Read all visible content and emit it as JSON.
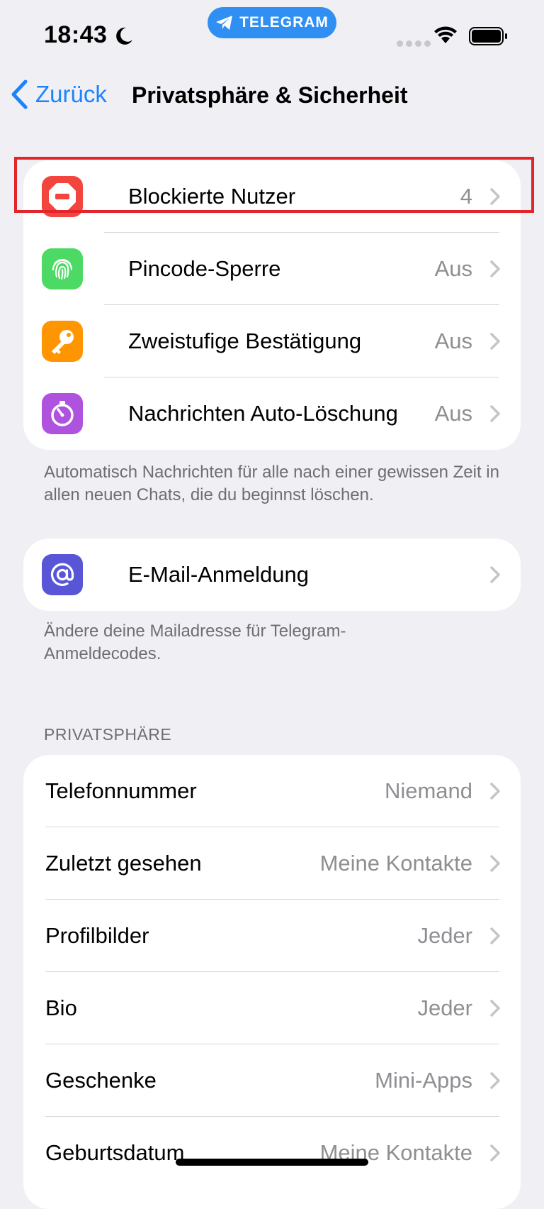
{
  "status": {
    "time": "18:43",
    "app_pill": "TELEGRAM"
  },
  "nav": {
    "back_label": "Zurück",
    "title": "Privatsphäre & Sicherheit"
  },
  "security": {
    "items": [
      {
        "label": "Blockierte Nutzer",
        "value": "4",
        "icon": "blocked-icon",
        "color": "#f2453d"
      },
      {
        "label": "Pincode-Sperre",
        "value": "Aus",
        "icon": "fingerprint-icon",
        "color": "#4cd964"
      },
      {
        "label": "Zweistufige Bestätigung",
        "value": "Aus",
        "icon": "key-icon",
        "color": "#ff9500"
      },
      {
        "label": "Nachrichten Auto-Löschung",
        "value": "Aus",
        "icon": "timer-icon",
        "color": "#af52de"
      }
    ],
    "footer": "Automatisch Nachrichten für alle nach einer gewissen Zeit in allen neuen Chats, die du beginnst löschen."
  },
  "email": {
    "label": "E-Mail-Anmeldung",
    "icon": "at-icon",
    "color": "#5856d6",
    "footer": "Ändere deine Mailadresse für Telegram-Anmeldecodes."
  },
  "privacy": {
    "header": "PRIVATSPHÄRE",
    "items": [
      {
        "label": "Telefonnummer",
        "value": "Niemand"
      },
      {
        "label": "Zuletzt gesehen",
        "value": "Meine Kontakte"
      },
      {
        "label": "Profilbilder",
        "value": "Jeder"
      },
      {
        "label": "Bio",
        "value": "Jeder"
      },
      {
        "label": "Geschenke",
        "value": "Mini-Apps"
      },
      {
        "label": "Geburtsdatum",
        "value": "Meine Kontakte"
      }
    ]
  }
}
